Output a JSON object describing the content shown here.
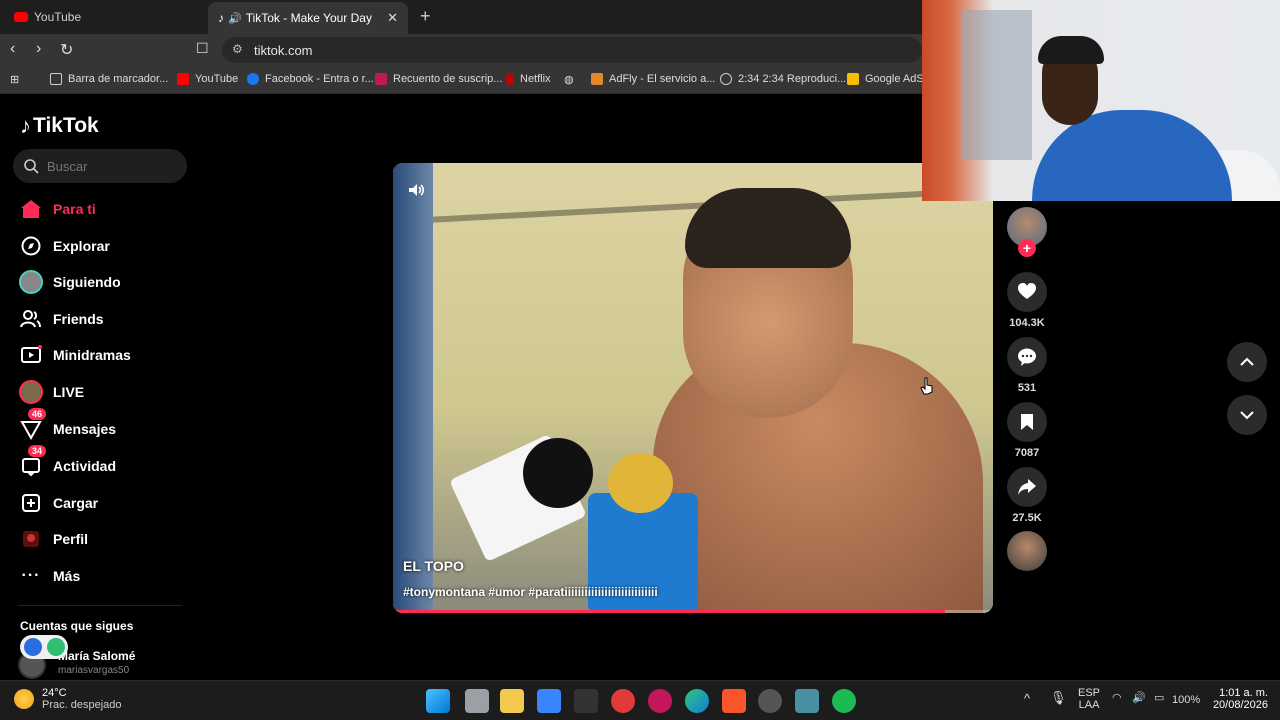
{
  "browser": {
    "tabs": [
      {
        "label": "YouTube",
        "color": "#ff0000"
      },
      {
        "label": "TikTok - Make Your Day",
        "color": "#ffffff"
      }
    ],
    "url": "tiktok.com",
    "bookmarks": [
      {
        "label": "Barra de marcador...",
        "icon": "folder-icon"
      },
      {
        "label": "YouTube",
        "icon": "youtube-icon"
      },
      {
        "label": "Facebook - Entra o r...",
        "icon": "facebook-icon"
      },
      {
        "label": "Recuento de suscrip...",
        "icon": "counter-icon"
      },
      {
        "label": "Netflix",
        "icon": "netflix-icon"
      },
      {
        "label": "AdFly - El servicio a...",
        "icon": "adfly-icon"
      },
      {
        "label": "2:34 2:34 Reproduci...",
        "icon": "globe-icon"
      },
      {
        "label": "Google AdSe",
        "icon": "adsense-icon"
      }
    ]
  },
  "sidebar": {
    "logo": "TikTok",
    "search_placeholder": "Buscar",
    "items": [
      {
        "label": "Para ti",
        "icon": "home-icon",
        "active": true
      },
      {
        "label": "Explorar",
        "icon": "compass-icon"
      },
      {
        "label": "Siguiendo",
        "icon": "following-icon"
      },
      {
        "label": "Friends",
        "icon": "friends-icon"
      },
      {
        "label": "Minidramas",
        "icon": "film-icon"
      },
      {
        "label": "LIVE",
        "icon": "live-icon"
      },
      {
        "label": "Mensajes",
        "icon": "messages-icon",
        "badge": "46"
      },
      {
        "label": "Actividad",
        "icon": "activity-icon",
        "badge": "34"
      },
      {
        "label": "Cargar",
        "icon": "upload-icon"
      },
      {
        "label": "Perfil",
        "icon": "profile-icon"
      },
      {
        "label": "Más",
        "icon": "more-icon"
      }
    ],
    "following_title": "Cuentas que sigues",
    "account": {
      "name": "María Salomé",
      "handle": "mariasvargas50"
    }
  },
  "video": {
    "title": "EL TOPO",
    "tags": "#tonymontana #umor #paratiiiiiiiiiiiiiiiiiiiiiiiiiiii",
    "progress": 0.92
  },
  "actions": {
    "likes": "104.3K",
    "comments": "531",
    "saves": "7087",
    "shares": "27.5K"
  },
  "taskbar": {
    "temp": "24°C",
    "condition": "Prac. despejado",
    "lang_top": "ESP",
    "lang_bottom": "LAA",
    "battery": "100%",
    "time": "1:01 a. m.",
    "date": "20/08/2026"
  },
  "colors": {
    "accent": "#fe2c55",
    "background": "#000000"
  }
}
